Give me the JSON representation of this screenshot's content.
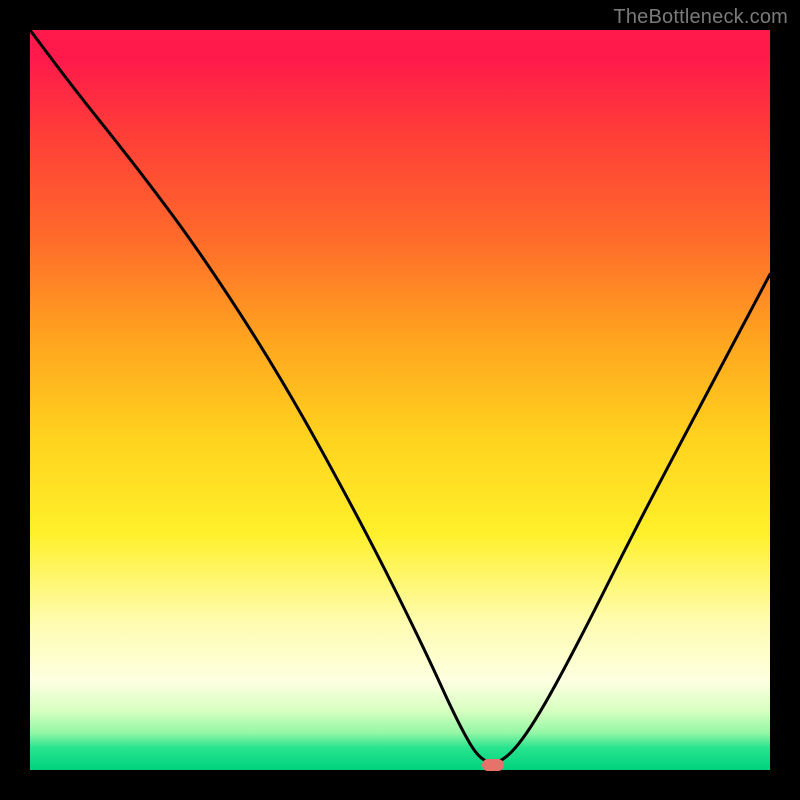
{
  "watermark": "TheBottleneck.com",
  "marker": {
    "x_pct": 62.5,
    "y_pct": 99.3,
    "color": "#e7716b"
  },
  "chart_data": {
    "type": "line",
    "title": "",
    "xlabel": "",
    "ylabel": "",
    "xlim": [
      0,
      100
    ],
    "ylim": [
      0,
      100
    ],
    "grid": false,
    "legend": false,
    "annotations": [
      {
        "text": "TheBottleneck.com",
        "position": "top-right"
      }
    ],
    "series": [
      {
        "name": "bottleneck-curve",
        "color": "#000000",
        "x": [
          0,
          6,
          14,
          23,
          34,
          45,
          53,
          58,
          61,
          64,
          68,
          74,
          82,
          91,
          100
        ],
        "y": [
          100,
          92,
          82,
          70,
          53,
          33,
          17,
          6,
          1,
          1,
          6,
          17,
          33,
          50,
          67
        ]
      }
    ],
    "marker_point": {
      "x": 62.5,
      "y": 0.7
    },
    "background_gradient": {
      "type": "vertical",
      "stops": [
        {
          "pct": 0,
          "color": "#ff1a4b"
        },
        {
          "pct": 28,
          "color": "#ff6a2a"
        },
        {
          "pct": 55,
          "color": "#ffd21e"
        },
        {
          "pct": 80,
          "color": "#fffcb0"
        },
        {
          "pct": 95,
          "color": "#92f7a5"
        },
        {
          "pct": 100,
          "color": "#00d27d"
        }
      ]
    }
  }
}
